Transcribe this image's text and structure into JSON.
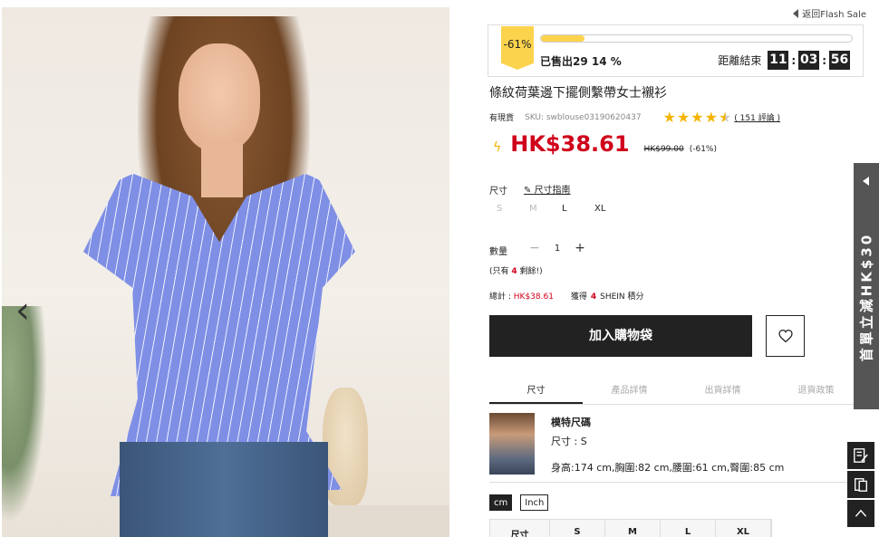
{
  "nav": {
    "back_label": "返回Flash Sale"
  },
  "flash_sale": {
    "discount": "-61%",
    "sold_text": "已售出29 14 %",
    "sold_percent": 14,
    "countdown_label": "距離結束",
    "hours": "11",
    "minutes": "03",
    "seconds": "56"
  },
  "product": {
    "title": "條紋荷葉邊下擺側繫帶女士襯衫",
    "stock_status": "有現貨",
    "sku": "SKU: swblouse03190620437",
    "rating": 4.5,
    "reviews_label": "( 151 評論 )",
    "price": "HK$38.61",
    "original_price": "HK$99.00",
    "discount_text": "(-61%)"
  },
  "size": {
    "label": "尺寸",
    "guide_label": "尺寸指南",
    "options": [
      {
        "label": "S",
        "available": false
      },
      {
        "label": "M",
        "available": false
      },
      {
        "label": "L",
        "available": true
      },
      {
        "label": "XL",
        "available": true
      }
    ]
  },
  "quantity": {
    "label": "數量",
    "value": "1",
    "minus": "−",
    "plus": "+",
    "stock_prefix": "(只有",
    "stock_count": "4",
    "stock_suffix": "剩餘!)"
  },
  "summary": {
    "total_label": "總計 :",
    "total_value": "HK$38.61",
    "points_prefix": "獲得",
    "points_value": "4",
    "points_suffix": "SHEIN 積分"
  },
  "actions": {
    "add_to_bag": "加入購物袋"
  },
  "tabs": [
    "尺寸",
    "產品詳情",
    "出貨詳情",
    "退貨政策"
  ],
  "model": {
    "title": "模特尺碼",
    "size": "尺寸 : S",
    "dims": "身高:174 cm,胸圍:82 cm,腰圍:61 cm,臀圍:85 cm"
  },
  "units": [
    "cm",
    "Inch"
  ],
  "size_table_headers": [
    "尺寸",
    "S",
    "M",
    "L",
    "XL"
  ],
  "promo_tab": "首單立減HK$30",
  "colors": {
    "price_red": "#d0021b",
    "flash_yellow": "#fcd34d",
    "dark": "#222222"
  }
}
